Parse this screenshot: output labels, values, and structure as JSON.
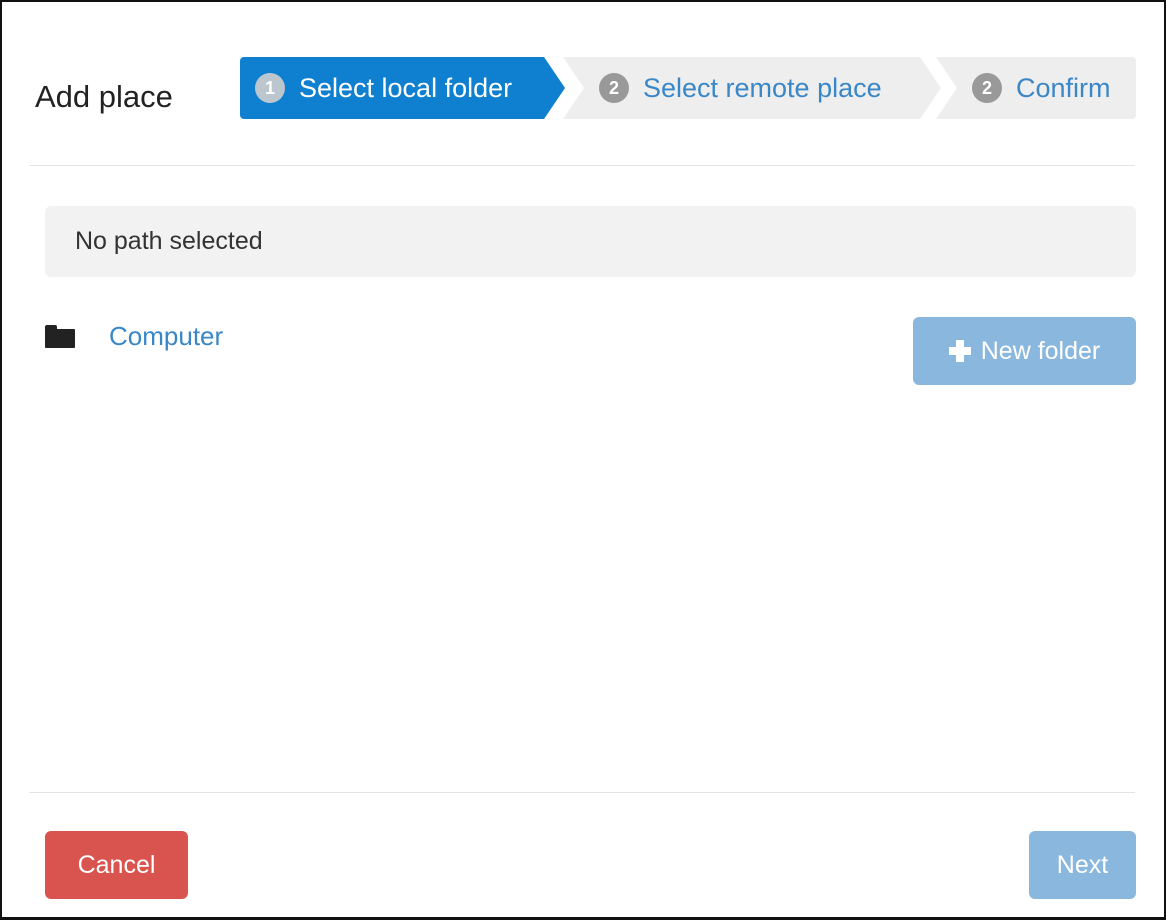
{
  "dialog": {
    "title": "Add place"
  },
  "wizard": {
    "steps": [
      {
        "number": "1",
        "label": "Select local folder",
        "state": "active"
      },
      {
        "number": "2",
        "label": "Select remote place",
        "state": "inactive"
      },
      {
        "number": "2",
        "label": "Confirm",
        "state": "inactive"
      }
    ]
  },
  "path": {
    "status": "No path selected"
  },
  "tree": {
    "items": [
      {
        "label": "Computer",
        "icon": "folder-icon"
      }
    ]
  },
  "buttons": {
    "new_folder": "New folder",
    "cancel": "Cancel",
    "next": "Next"
  },
  "colors": {
    "active_step": "#0f7fd0",
    "inactive_step": "#eeeeee",
    "link": "#3a87c8",
    "cancel": "#d9534f",
    "disabled_primary": "#8ab7de"
  }
}
